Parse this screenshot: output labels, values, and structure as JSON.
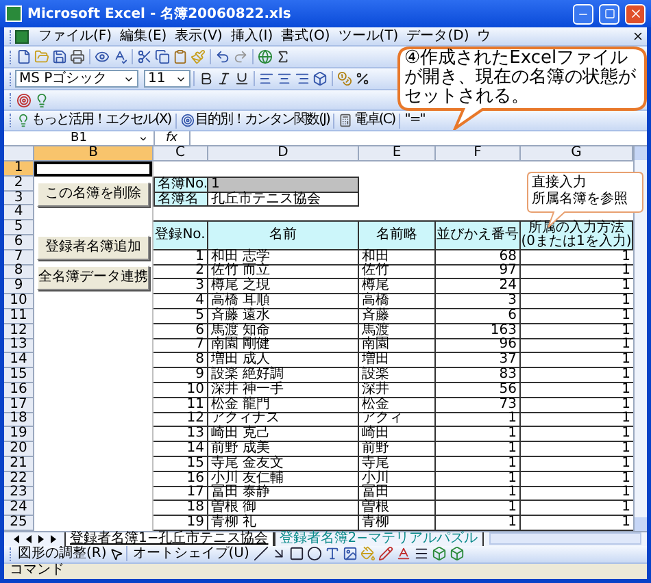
{
  "window": {
    "title": "Microsoft Excel - 名簿20060822.xls"
  },
  "menu": [
    {
      "label": "ファイル(F)"
    },
    {
      "label": "編集(E)"
    },
    {
      "label": "表示(V)"
    },
    {
      "label": "挿入(I)"
    },
    {
      "label": "書式(O)"
    },
    {
      "label": "ツール(T)"
    },
    {
      "label": "データ(D)"
    },
    {
      "label": "ウ"
    }
  ],
  "format_bar": {
    "font": "MS Pゴシック",
    "size": "11"
  },
  "custom_toolbar": [
    "もっと活用！エクセル(X)",
    "目的別！カンタン関数(J)",
    "電卓(C)",
    "\"=\""
  ],
  "formula_bar": {
    "name_box": "B1",
    "fx": "fx"
  },
  "column_headers": [
    {
      "label": "B",
      "selected": true
    },
    {
      "label": "C",
      "selected": false
    },
    {
      "label": "D",
      "selected": false
    },
    {
      "label": "E",
      "selected": false
    },
    {
      "label": "F",
      "selected": false
    },
    {
      "label": "G",
      "selected": false
    }
  ],
  "row_headers": [
    {
      "label": "1",
      "selected": true
    },
    {
      "label": "2",
      "selected": false
    },
    {
      "label": "3",
      "selected": false
    },
    {
      "label": "4",
      "selected": false
    },
    {
      "label": "5",
      "selected": false
    },
    {
      "label": "6",
      "selected": false
    },
    {
      "label": "7",
      "selected": false
    },
    {
      "label": "8",
      "selected": false
    },
    {
      "label": "9",
      "selected": false
    },
    {
      "label": "10",
      "selected": false
    },
    {
      "label": "11",
      "selected": false
    },
    {
      "label": "12",
      "selected": false
    },
    {
      "label": "13",
      "selected": false
    },
    {
      "label": "14",
      "selected": false
    },
    {
      "label": "15",
      "selected": false
    },
    {
      "label": "16",
      "selected": false
    },
    {
      "label": "17",
      "selected": false
    },
    {
      "label": "18",
      "selected": false
    },
    {
      "label": "19",
      "selected": false
    },
    {
      "label": "20",
      "selected": false
    },
    {
      "label": "21",
      "selected": false
    },
    {
      "label": "22",
      "selected": false
    },
    {
      "label": "23",
      "selected": false
    },
    {
      "label": "24",
      "selected": false
    },
    {
      "label": "25",
      "selected": false
    }
  ],
  "sheet_buttons": [
    "この名簿を削除",
    "登録者名簿追加",
    "全名簿データ連携"
  ],
  "roster_info": [
    {
      "label": "名簿No.",
      "value": "1"
    },
    {
      "label": "名簿名",
      "value": "孔丘市テニス協会"
    }
  ],
  "table": {
    "columns": [
      "登録No.",
      "名前",
      "名前略",
      "並びかえ番号",
      "所属の入力方法\n(0または1を入力)"
    ],
    "rows": [
      {
        "no": "1",
        "name": "和田 志学",
        "short": "和田",
        "sort": "68",
        "input": "1"
      },
      {
        "no": "2",
        "name": "佐竹 而立",
        "short": "佐竹",
        "sort": "97",
        "input": "1"
      },
      {
        "no": "3",
        "name": "樽尾 之現",
        "short": "樽尾",
        "sort": "24",
        "input": "1"
      },
      {
        "no": "4",
        "name": "高橋 耳順",
        "short": "高橋",
        "sort": "3",
        "input": "1"
      },
      {
        "no": "5",
        "name": "斉藤 遠水",
        "short": "斉藤",
        "sort": "6",
        "input": "1"
      },
      {
        "no": "6",
        "name": "馬渡 知命",
        "short": "馬渡",
        "sort": "163",
        "input": "1"
      },
      {
        "no": "7",
        "name": "南園 剛健",
        "short": "南園",
        "sort": "96",
        "input": "1"
      },
      {
        "no": "8",
        "name": "増田 成人",
        "short": "増田",
        "sort": "37",
        "input": "1"
      },
      {
        "no": "9",
        "name": "設楽 絶好調",
        "short": "設楽",
        "sort": "83",
        "input": "1"
      },
      {
        "no": "10",
        "name": "深井 神一手",
        "short": "深井",
        "sort": "56",
        "input": "1"
      },
      {
        "no": "11",
        "name": "松金 龍門",
        "short": "松金",
        "sort": "73",
        "input": "1"
      },
      {
        "no": "12",
        "name": "アクィナス",
        "short": "アクィ",
        "sort": "1",
        "input": "1"
      },
      {
        "no": "13",
        "name": "崎田 克己",
        "short": "崎田",
        "sort": "1",
        "input": "1"
      },
      {
        "no": "14",
        "name": "前野 成美",
        "short": "前野",
        "sort": "1",
        "input": "1"
      },
      {
        "no": "15",
        "name": "寺尾 金友文",
        "short": "寺尾",
        "sort": "1",
        "input": "1"
      },
      {
        "no": "16",
        "name": "小川 友仁輔",
        "short": "小川",
        "sort": "1",
        "input": "1"
      },
      {
        "no": "17",
        "name": "冨田 泰静",
        "short": "冨田",
        "sort": "1",
        "input": "1"
      },
      {
        "no": "18",
        "name": "曽根 御",
        "short": "曽根",
        "sort": "1",
        "input": "1"
      },
      {
        "no": "19",
        "name": "青柳 礼",
        "short": "青柳",
        "sort": "1",
        "input": "1"
      }
    ]
  },
  "sheet_tabs": [
    {
      "label": "登録者名簿1−孔丘市テニス協会",
      "selected": true
    },
    {
      "label": "登録者名簿2−マテリアルパズル",
      "selected": false
    }
  ],
  "draw_toolbar": [
    "図形の調整(R)",
    "オートシェイプ(U)"
  ],
  "status_bar": "コマンド",
  "callout": "④作成されたExcelファイルが開き、現在の名簿の状態がセットされる。",
  "note_callout": [
    "直接入力",
    "所属名簿を参照"
  ]
}
